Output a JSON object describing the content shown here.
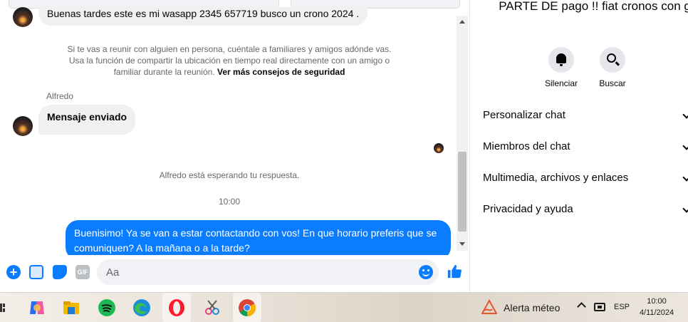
{
  "chat": {
    "top_message": "Buenas tardes este es mi wasapp 2345 657719 busco un crono 2024 .",
    "safety_notice": "Si te vas a reunir con alguien en persona, cuéntale a familiares y amigos adónde vas. Usa la función de compartir la ubicación en tiempo real directamente con un amigo o familiar durante la reunión.",
    "safety_link": "Ver más consejos de seguridad",
    "sender_name": "Alfredo",
    "incoming_message": "Mensaje enviado",
    "waiting_status": "Alfredo está esperando tu respuesta.",
    "timestamp": "10:00",
    "outgoing_message": "Buenisimo! Ya se van a estar contactando con vos! En que horario preferis que se comuniquen? A la mañana o a la tarde?"
  },
  "composer": {
    "placeholder": "Aa",
    "icons": [
      "plus-icon",
      "image-icon",
      "sticker-icon",
      "gif-icon",
      "emoji-icon",
      "like-icon"
    ],
    "gif_label": "GIF"
  },
  "info": {
    "title": "PARTE DE pago !! fiat cronos con gnc",
    "actions": [
      {
        "label": "Silenciar",
        "icon": "bell-icon"
      },
      {
        "label": "Buscar",
        "icon": "search-icon"
      }
    ],
    "menu": [
      {
        "label": "Personalizar chat"
      },
      {
        "label": "Miembros del chat"
      },
      {
        "label": "Multimedia, archivos y enlaces"
      },
      {
        "label": "Privacidad y ayuda"
      }
    ]
  },
  "taskbar": {
    "apps": [
      "copilot-icon",
      "file-explorer-icon",
      "spotify-icon",
      "edge-icon",
      "opera-icon",
      "snipping-tool-icon",
      "chrome-icon"
    ],
    "weather_label": "Alerta méteo",
    "language": "ESP",
    "time": "10:00",
    "date": "4/11/2024"
  },
  "colors": {
    "messenger_blue": "#0a7cff",
    "bubble_gray": "#f0f0f0",
    "text_secondary": "#65676b"
  }
}
